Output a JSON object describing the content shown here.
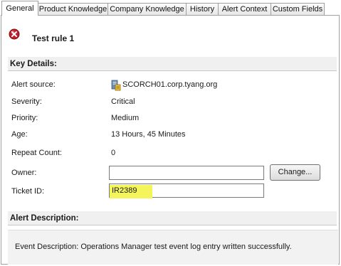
{
  "tabs": [
    {
      "label": "General",
      "active": true
    },
    {
      "label": "Product Knowledge",
      "active": false
    },
    {
      "label": "Company Knowledge",
      "active": false
    },
    {
      "label": "History",
      "active": false
    },
    {
      "label": "Alert Context",
      "active": false
    },
    {
      "label": "Custom Fields",
      "active": false
    }
  ],
  "alert": {
    "name": "Test rule 1",
    "icon": "error-icon"
  },
  "key_details": {
    "heading": "Key Details:",
    "fields": {
      "alert_source": {
        "label": "Alert source:",
        "value": "SCORCH01.corp.tyang.org",
        "icon": "server-icon"
      },
      "severity": {
        "label": "Severity:",
        "value": "Critical"
      },
      "priority": {
        "label": "Priority:",
        "value": "Medium"
      },
      "age": {
        "label": "Age:",
        "value": "13 Hours, 45 Minutes"
      },
      "repeat_count": {
        "label": "Repeat Count:",
        "value": "0"
      },
      "owner": {
        "label": "Owner:",
        "value": "",
        "button_label": "Change..."
      },
      "ticket_id": {
        "label": "Ticket ID:",
        "value": "IR2389"
      }
    }
  },
  "description": {
    "heading": "Alert Description:",
    "text": "Event Description: Operations Manager test event log entry written successfully."
  },
  "colors": {
    "highlight": "#f3f55a",
    "error": "#c0202a",
    "section_bg": "#f0f0f0"
  }
}
